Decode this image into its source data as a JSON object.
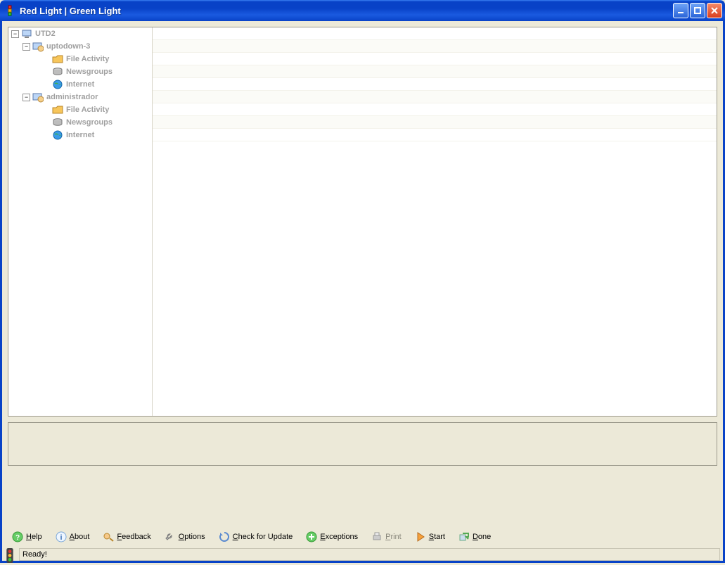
{
  "window": {
    "title": "Red Light  |  Green Light"
  },
  "tree": {
    "root": {
      "label": "UTD2",
      "expanded": true,
      "children": [
        {
          "label": "uptodown-3",
          "expanded": true,
          "children": [
            {
              "label": "File Activity",
              "icon": "folder-icon"
            },
            {
              "label": "Newsgroups",
              "icon": "disk-icon"
            },
            {
              "label": "Internet",
              "icon": "globe-icon"
            }
          ]
        },
        {
          "label": "administrador",
          "expanded": true,
          "children": [
            {
              "label": "File Activity",
              "icon": "folder-icon"
            },
            {
              "label": "Newsgroups",
              "icon": "disk-icon"
            },
            {
              "label": "Internet",
              "icon": "globe-icon"
            }
          ]
        }
      ]
    }
  },
  "toolbar": {
    "help": {
      "label": "Help",
      "accel": "H",
      "icon": "help-icon"
    },
    "about": {
      "label": "About",
      "accel": "A",
      "icon": "info-icon"
    },
    "feedback": {
      "label": "Feedback",
      "accel": "F",
      "icon": "feedback-icon"
    },
    "options": {
      "label": "Options",
      "accel": "O",
      "icon": "wrench-icon"
    },
    "update": {
      "label": "Check for Update",
      "accel": "C",
      "icon": "refresh-icon"
    },
    "exceptions": {
      "label": "Exceptions",
      "accel": "E",
      "icon": "plus-icon"
    },
    "print": {
      "label": "Print",
      "accel": "P",
      "icon": "print-icon",
      "disabled": true
    },
    "start": {
      "label": "Start",
      "accel": "S",
      "icon": "play-icon"
    },
    "done": {
      "label": "Done",
      "accel": "D",
      "icon": "done-icon"
    }
  },
  "status": {
    "text": "Ready!"
  }
}
